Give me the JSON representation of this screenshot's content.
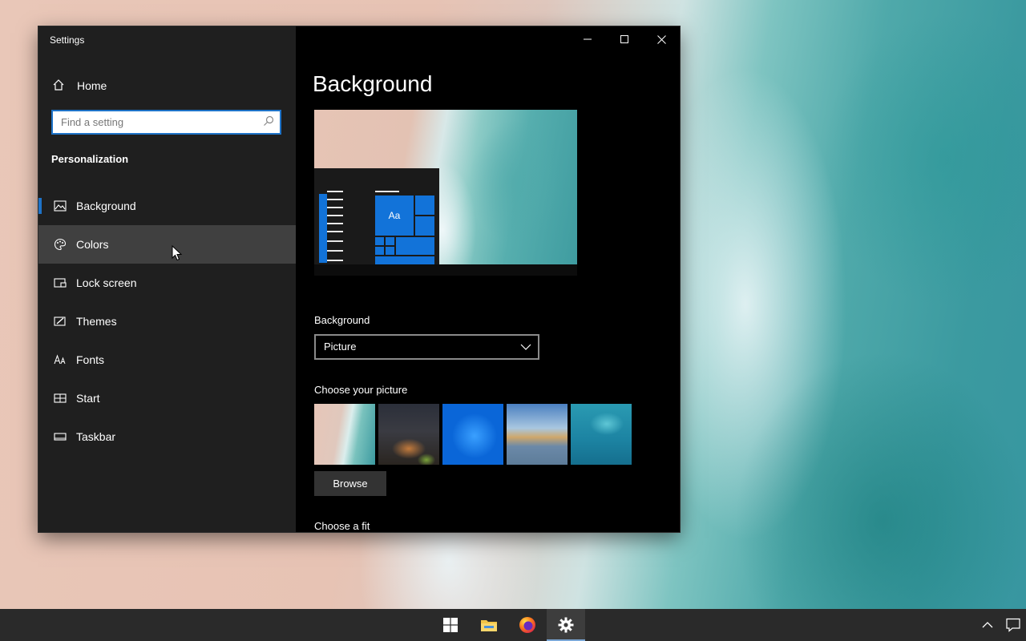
{
  "window": {
    "app_title": "Settings",
    "controls": [
      "minimize-icon",
      "maximize-icon",
      "close-icon"
    ]
  },
  "sidebar": {
    "home_label": "Home",
    "search_placeholder": "Find a setting",
    "section_title": "Personalization",
    "items": [
      {
        "label": "Background",
        "icon": "background-icon",
        "selected": true
      },
      {
        "label": "Colors",
        "icon": "palette-icon",
        "hovered": true
      },
      {
        "label": "Lock screen",
        "icon": "lock-screen-icon"
      },
      {
        "label": "Themes",
        "icon": "themes-icon"
      },
      {
        "label": "Fonts",
        "icon": "fonts-icon"
      },
      {
        "label": "Start",
        "icon": "start-icon"
      },
      {
        "label": "Taskbar",
        "icon": "taskbar-icon"
      }
    ]
  },
  "main": {
    "page_title": "Background",
    "preview_tile_text": "Aa",
    "background_label": "Background",
    "background_value": "Picture",
    "choose_picture_label": "Choose your picture",
    "browse_label": "Browse",
    "choose_fit_label": "Choose a fit"
  },
  "taskbar": {
    "icons": [
      "windows-start-icon",
      "file-explorer-icon",
      "firefox-icon",
      "settings-gear-icon"
    ],
    "active": "settings-gear-icon",
    "tray": [
      "chevron-up-icon",
      "action-center-icon"
    ]
  },
  "colors": {
    "accent": "#1e73c8",
    "sidebar_bg": "#1f1f1f",
    "content_bg": "#000000",
    "hover_bg": "#404040",
    "taskbar_bg": "#2a2a2a"
  }
}
